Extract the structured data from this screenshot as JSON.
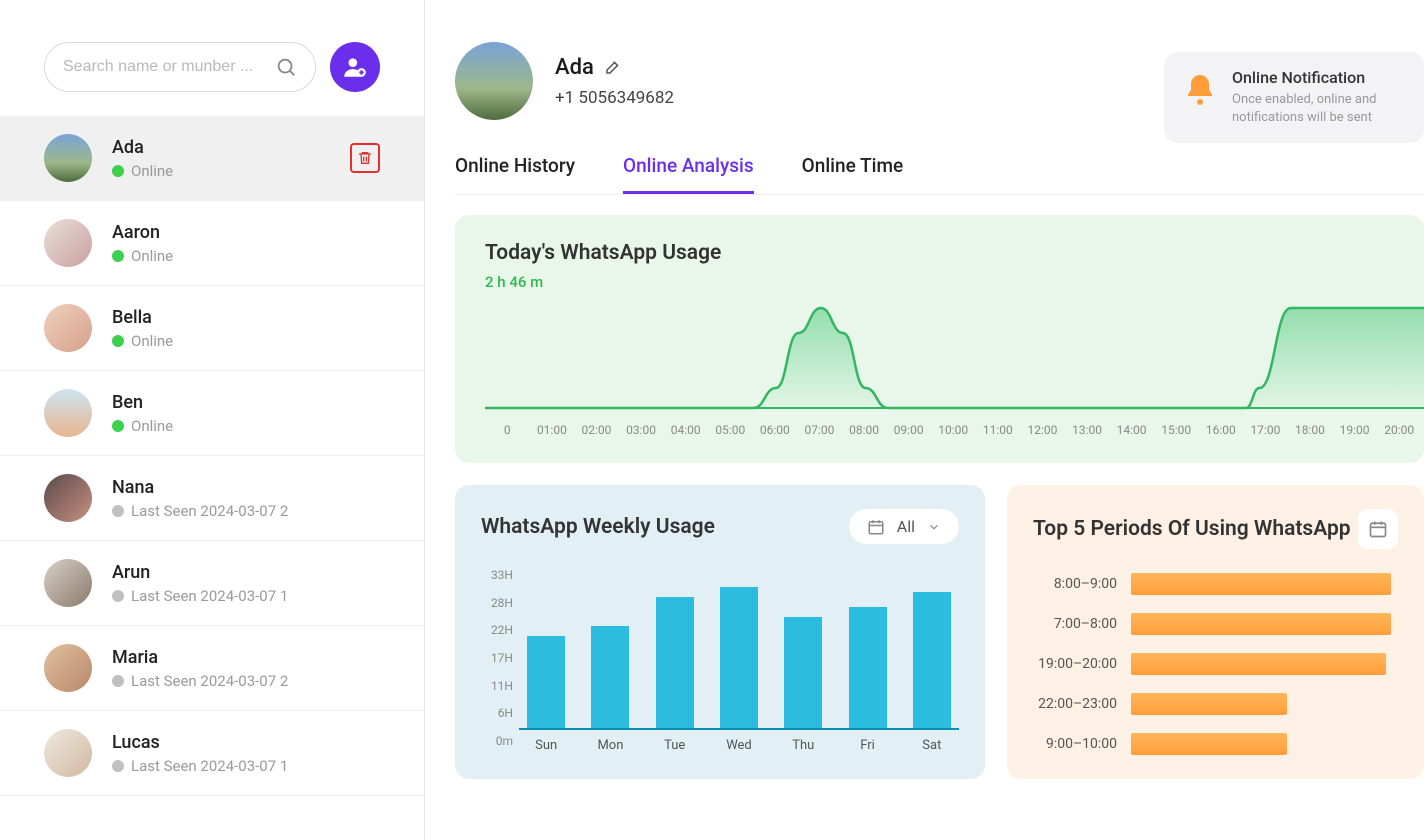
{
  "search": {
    "placeholder": "Search name or munber ..."
  },
  "contacts": [
    {
      "name": "Ada",
      "status_text": "Online",
      "online": true,
      "selected": true
    },
    {
      "name": "Aaron",
      "status_text": "Online",
      "online": true
    },
    {
      "name": "Bella",
      "status_text": "Online",
      "online": true
    },
    {
      "name": "Ben",
      "status_text": "Online",
      "online": true
    },
    {
      "name": "Nana",
      "status_text": "Last Seen 2024-03-07 2",
      "online": false
    },
    {
      "name": "Arun",
      "status_text": "Last Seen 2024-03-07 1",
      "online": false
    },
    {
      "name": "Maria",
      "status_text": "Last Seen 2024-03-07 2",
      "online": false
    },
    {
      "name": "Lucas",
      "status_text": "Last Seen 2024-03-07 1",
      "online": false
    }
  ],
  "profile": {
    "name": "Ada",
    "phone": "+1 5056349682"
  },
  "notification": {
    "title": "Online Notification",
    "subtitle": "Once enabled, online and notifications will be sent"
  },
  "tabs": {
    "history": "Online History",
    "analysis": "Online Analysis",
    "time": "Online Time"
  },
  "today_card": {
    "title": "Today's WhatsApp Usage",
    "duration": "2 h 46 m"
  },
  "weekly_card": {
    "title": "WhatsApp Weekly Usage",
    "filter": "All"
  },
  "top5_card": {
    "title": "Top 5 Periods Of Using WhatsApp"
  },
  "chart_data": [
    {
      "type": "area",
      "title": "Today's WhatsApp Usage",
      "x_ticks": [
        "0",
        "01:00",
        "02:00",
        "03:00",
        "04:00",
        "05:00",
        "06:00",
        "07:00",
        "08:00",
        "09:00",
        "10:00",
        "11:00",
        "12:00",
        "13:00",
        "14:00",
        "15:00",
        "16:00",
        "17:00",
        "18:00",
        "19:00",
        "20:00"
      ],
      "series": [
        {
          "name": "usage",
          "x": [
            0,
            1,
            2,
            3,
            4,
            5,
            6,
            6.5,
            7,
            7.5,
            8,
            8.5,
            9,
            10,
            11,
            12,
            13,
            14,
            15,
            16,
            17,
            17.3,
            18,
            19,
            20,
            21
          ],
          "y": [
            0,
            0,
            0,
            0,
            0,
            0,
            0,
            0.2,
            0.75,
            1.0,
            0.75,
            0.2,
            0,
            0,
            0,
            0,
            0,
            0,
            0,
            0,
            0,
            0.2,
            1.0,
            1.0,
            1.0,
            1.0
          ]
        }
      ],
      "ylim": [
        0,
        1
      ]
    },
    {
      "type": "bar",
      "title": "WhatsApp Weekly Usage",
      "y_ticks": [
        "33H",
        "28H",
        "22H",
        "17H",
        "11H",
        "6H",
        "0m"
      ],
      "categories": [
        "Sun",
        "Mon",
        "Tue",
        "Wed",
        "Thu",
        "Fri",
        "Sat"
      ],
      "values": [
        19,
        21,
        27,
        29,
        23,
        25,
        28
      ],
      "ylim": [
        0,
        33
      ]
    },
    {
      "type": "bar",
      "title": "Top 5 Periods Of Using WhatsApp",
      "categories": [
        "8:00–9:00",
        "7:00–8:00",
        "19:00–20:00",
        "22:00–23:00",
        "9:00–10:00"
      ],
      "values": [
        100,
        100,
        98,
        60,
        60
      ]
    }
  ]
}
